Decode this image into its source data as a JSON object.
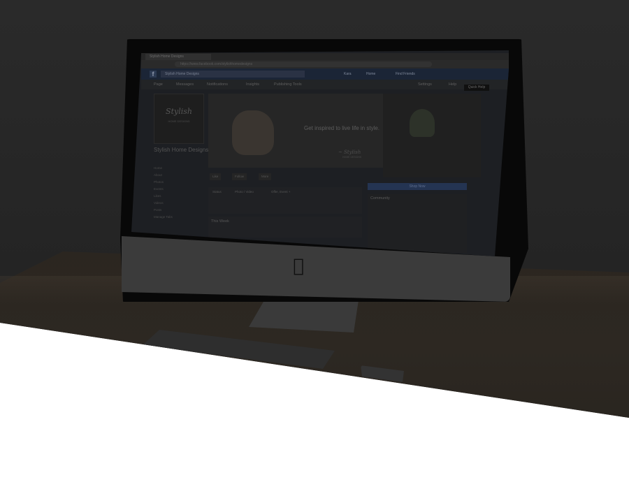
{
  "browser": {
    "tab_title": "Stylish Home Designs",
    "url": "https://www.facebook.com/stylishhomedesigns"
  },
  "facebook": {
    "logo": "f",
    "search_value": "Stylish Home Designs",
    "user_label": "Kara",
    "home_label": "Home",
    "find_friends_label": "Find Friends",
    "quick_help_label": "Quick Help"
  },
  "page_tabs": [
    "Page",
    "Messages",
    "Notifications",
    "Insights",
    "Publishing Tools"
  ],
  "page_tab_right": [
    "Settings",
    "Help"
  ],
  "profile": {
    "logo_script": "Stylish",
    "logo_sub": "HOME DESIGNS",
    "page_name": "Stylish Home Designs",
    "nav_items": [
      "Home",
      "About",
      "Photos",
      "Events",
      "Likes",
      "Videos",
      "Posts",
      "Manage Tabs"
    ]
  },
  "cover": {
    "tagline": "Get inspired to live life in style.",
    "signature": "~ Stylish",
    "signature_sub": "HOME DESIGNS"
  },
  "actions": {
    "like": "Like",
    "follow": "Follow",
    "more": "More",
    "status": "Status",
    "photo_video": "Photo / Video",
    "offer_event": "Offer, Event +"
  },
  "right": {
    "shop_button": "Shop Now",
    "community_title": "Community"
  },
  "feed": {
    "this_week_title": "This Week"
  },
  "colors": {
    "overlay_dark": "#242424",
    "facebook_bar": "#1b2536",
    "page_background": "#ffffff"
  }
}
